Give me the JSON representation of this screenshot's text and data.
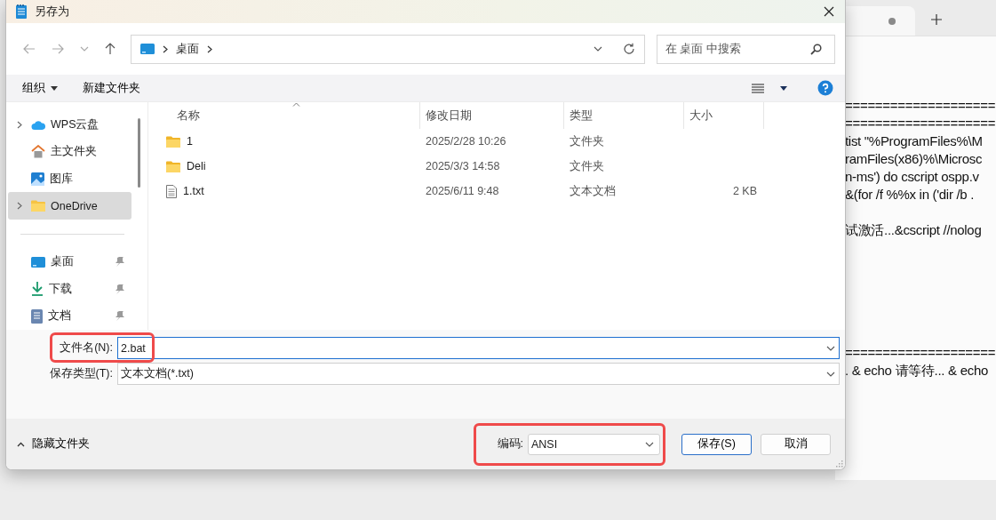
{
  "dialog": {
    "title": "另存为",
    "address": {
      "crumbs": [
        "桌面"
      ]
    },
    "search": {
      "placeholder": "在 桌面 中搜索"
    },
    "toolbar": {
      "organize": "组织",
      "new_folder": "新建文件夹"
    },
    "sidebar": {
      "locations": [
        {
          "label": "WPS云盘",
          "kind": "cloud",
          "expandable": true,
          "selected": false
        },
        {
          "label": "主文件夹",
          "kind": "home",
          "expandable": false,
          "selected": false
        },
        {
          "label": "图库",
          "kind": "gallery",
          "expandable": false,
          "selected": false
        },
        {
          "label": "OneDrive",
          "kind": "folder",
          "expandable": true,
          "selected": true
        }
      ],
      "quick_access": [
        {
          "label": "桌面",
          "kind": "desktop",
          "pinned": true
        },
        {
          "label": "下载",
          "kind": "download",
          "pinned": true
        },
        {
          "label": "文档",
          "kind": "document",
          "pinned": true
        }
      ]
    },
    "table": {
      "columns": [
        "名称",
        "修改日期",
        "类型",
        "大小"
      ],
      "rows": [
        {
          "name": "1",
          "kind": "folder",
          "modified": "2025/2/28 10:26",
          "type": "文件夹"
        },
        {
          "name": "Deli",
          "kind": "folder",
          "modified": "2025/3/3 14:58",
          "type": "文件夹"
        },
        {
          "name": "1.txt",
          "kind": "text",
          "modified": "2025/6/11 9:48",
          "type": "文本文档",
          "size": "2 KB"
        }
      ]
    },
    "file_name": {
      "label": "文件名(N):",
      "value": "2.bat"
    },
    "file_type": {
      "label": "保存类型(T):",
      "value": "文本文档(*.txt)"
    },
    "hide_folders": "隐藏文件夹",
    "encoding": {
      "label": "编码:",
      "value": "ANSI"
    },
    "buttons": [
      {
        "label": "保存(S)",
        "kind": "primary"
      },
      {
        "label": "取消",
        "kind": "normal"
      }
    ]
  },
  "editor": {
    "blocks": [
      [
        "====================",
        "====================",
        "tist \"%ProgramFiles%\\M",
        "ramFiles(x86)%\\Microsc",
        "n-ms') do cscript ospp.v",
        "&(for /f %%x in ('dir /b ."
      ],
      [
        "试激活...&cscript //nolog"
      ],
      [
        "====================",
        ". & echo 请等待... & echo"
      ]
    ]
  }
}
